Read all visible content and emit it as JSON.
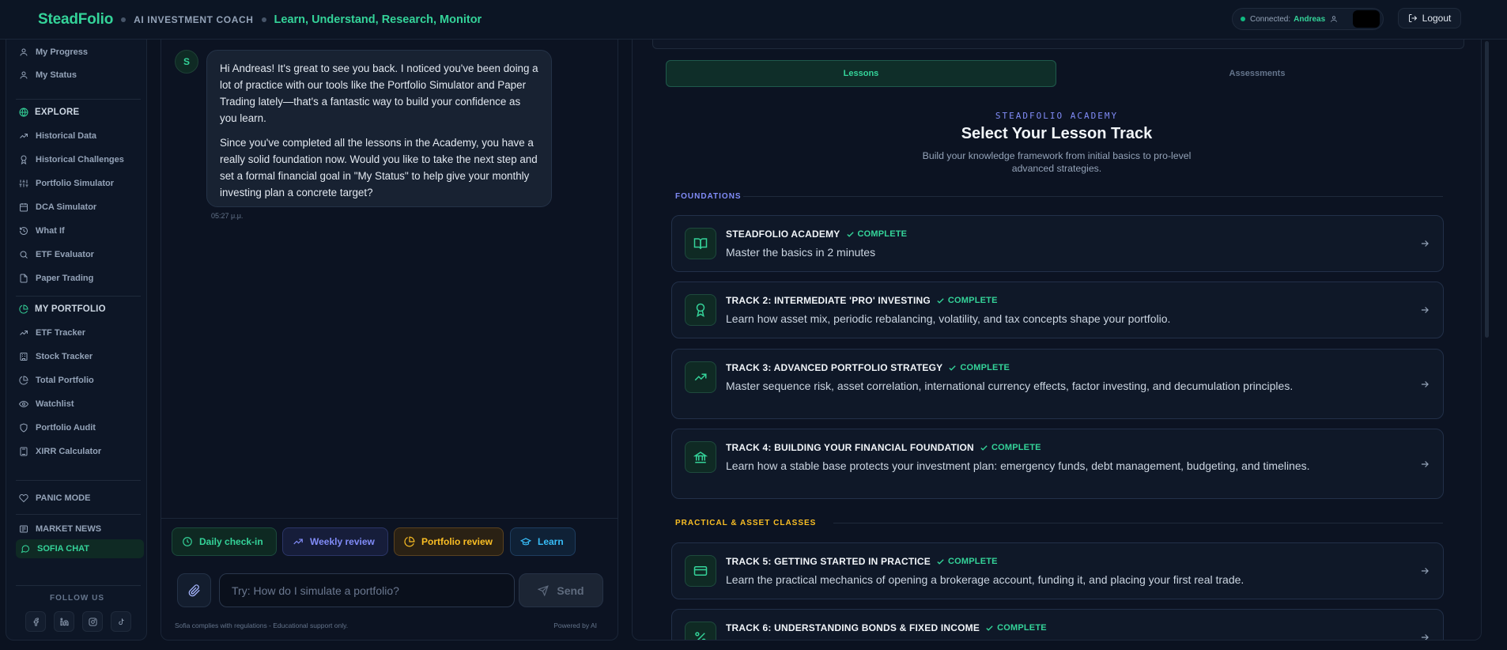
{
  "header": {
    "brand": "SteadFolio",
    "coach_label": "AI INVESTMENT COACH",
    "tagline": "Learn, Understand, Research, Monitor",
    "connection_label": "Connected:",
    "connected_user": "Andreas",
    "logout_label": "Logout"
  },
  "sidebar": {
    "top_items": [
      {
        "label": "My Progress",
        "icon": "user-icon"
      },
      {
        "label": "My Status",
        "icon": "user-icon"
      }
    ],
    "explore": {
      "header": "EXPLORE",
      "items": [
        {
          "label": "Historical Data",
          "icon": "trending-up-icon"
        },
        {
          "label": "Historical Challenges",
          "icon": "award-icon"
        },
        {
          "label": "Portfolio Simulator",
          "icon": "sliders-icon"
        },
        {
          "label": "DCA Simulator",
          "icon": "calendar-icon"
        },
        {
          "label": "What If",
          "icon": "history-icon"
        },
        {
          "label": "ETF Evaluator",
          "icon": "search-icon"
        },
        {
          "label": "Paper Trading",
          "icon": "file-icon"
        }
      ]
    },
    "portfolio": {
      "header": "MY PORTFOLIO",
      "items": [
        {
          "label": "ETF Tracker",
          "icon": "trending-up-icon"
        },
        {
          "label": "Stock Tracker",
          "icon": "building-icon"
        },
        {
          "label": "Total Portfolio",
          "icon": "pie-chart-icon"
        },
        {
          "label": "Watchlist",
          "icon": "eye-icon"
        },
        {
          "label": "Portfolio Audit",
          "icon": "shield-icon"
        },
        {
          "label": "XIRR Calculator",
          "icon": "calculator-icon"
        }
      ]
    },
    "panic_mode": "PANIC MODE",
    "market_news": "MARKET NEWS",
    "sofia_chat": "SOFIA CHAT",
    "follow_us": "FOLLOW US",
    "socials": [
      "facebook-icon",
      "linkedin-icon",
      "instagram-icon",
      "tiktok-icon"
    ]
  },
  "chat": {
    "avatar_letter": "S",
    "message_paragraphs": [
      "Hi Andreas! It's great to see you back. I noticed you've been doing a lot of practice with our tools like the Portfolio Simulator and Paper Trading lately—that's a fantastic way to build your confidence as you learn.",
      "Since you've completed all the lessons in the Academy, you have a really solid foundation now. Would you like to take the next step and set a formal financial goal in \"My Status\" to help give your monthly investing plan a concrete target?"
    ],
    "timestamp": "05:27 μ.μ.",
    "quick_actions": {
      "daily": "Daily check-in",
      "weekly": "Weekly review",
      "portfolio": "Portfolio review",
      "learn": "Learn"
    },
    "input_placeholder": "Try: How do I simulate a portfolio?",
    "send_label": "Send",
    "compliance": "Sofia complies with regulations - Educational support only.",
    "powered_by": "Powered by AI"
  },
  "lessons": {
    "tabs": {
      "lessons": "Lessons",
      "assessments": "Assessments"
    },
    "academy_label": "STEADFOLIO ACADEMY",
    "title": "Select Your Lesson Track",
    "subtitle": "Build your knowledge framework from initial basics to pro-level advanced strategies.",
    "sections": {
      "foundations": "FOUNDATIONS",
      "practical": "PRACTICAL & ASSET CLASSES"
    },
    "tracks": [
      {
        "title": "STEADFOLIO ACADEMY",
        "status": "COMPLETE",
        "description": "Master the basics in 2 minutes",
        "icon": "book-open-icon"
      },
      {
        "title": "TRACK 2: INTERMEDIATE 'PRO' INVESTING",
        "status": "COMPLETE",
        "description": "Learn how asset mix, periodic rebalancing, volatility, and tax concepts shape your portfolio.",
        "icon": "award-icon"
      },
      {
        "title": "TRACK 3: ADVANCED PORTFOLIO STRATEGY",
        "status": "COMPLETE",
        "description": "Master sequence risk, asset correlation, international currency effects, factor investing, and decumulation principles.",
        "icon": "trending-up-icon"
      },
      {
        "title": "TRACK 4: BUILDING YOUR FINANCIAL FOUNDATION",
        "status": "COMPLETE",
        "description": "Learn how a stable base protects your investment plan: emergency funds, debt management, budgeting, and timelines.",
        "icon": "bank-icon"
      },
      {
        "title": "TRACK 5: GETTING STARTED IN PRACTICE",
        "status": "COMPLETE",
        "description": "Learn the practical mechanics of opening a brokerage account, funding it, and placing your first real trade.",
        "icon": "credit-card-icon"
      },
      {
        "title": "TRACK 6: UNDERSTANDING BONDS & FIXED INCOME",
        "status": "COMPLETE",
        "description": "",
        "icon": "percent-icon"
      }
    ]
  },
  "colors": {
    "accent": "#34d399",
    "background": "#0b1220",
    "panel": "#0c1322",
    "indigo": "#818cf8",
    "amber": "#fbbf24",
    "blue": "#38bdf8"
  }
}
